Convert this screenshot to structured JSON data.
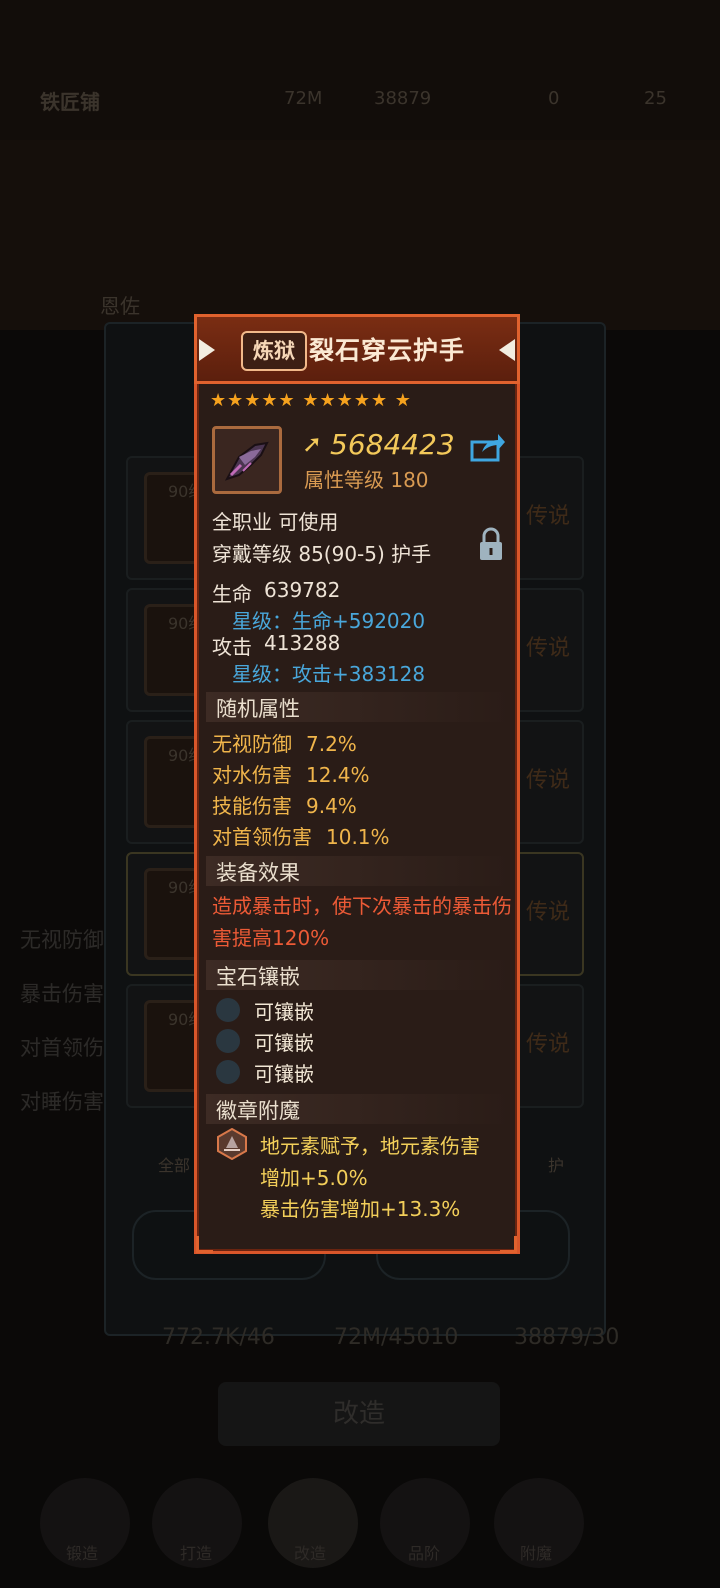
{
  "background": {
    "shop_name": "铁匠铺",
    "gold": "72M",
    "gems": "38879",
    "res_a": "0",
    "res_b": "25",
    "section_label": "恩佐",
    "row_level": "90级",
    "row_tag": "传说",
    "left_items": [
      "无视防御",
      "暴击伤害",
      "对首领伤",
      "对睡伤害"
    ],
    "filter_all": "全部",
    "filter_hand": "护",
    "stats": {
      "a": "772.7K/46",
      "b": "72M/45010",
      "c": "38879/30"
    },
    "modify_btn": "改造",
    "nav": [
      "锻造",
      "打造",
      "改造",
      "品阶",
      "附魔"
    ]
  },
  "item": {
    "tier_badge": "炼狱",
    "name": "裂石穿云护手",
    "stars": "★★★★★ ★★★★★ ★",
    "power": "5684423",
    "attr_level": "属性等级 180",
    "class_req": "全职业 可使用",
    "wear_req": "穿戴等级 85(90-5) 护手",
    "base_stats": [
      {
        "label": "生命",
        "value": "639782",
        "star_bonus": "星级：生命+592020"
      },
      {
        "label": "攻击",
        "value": "413288",
        "star_bonus": "星级：攻击+383128"
      }
    ],
    "random_title": "随机属性",
    "random_attrs": [
      {
        "label": "无视防御",
        "value": "7.2%"
      },
      {
        "label": "对水伤害",
        "value": "12.4%"
      },
      {
        "label": "技能伤害",
        "value": "9.4%"
      },
      {
        "label": "对首领伤害",
        "value": "10.1%"
      }
    ],
    "effect_title": "装备效果",
    "effect_text": "造成暴击时，使下次暴击的暴击伤害提高120%",
    "gem_title": "宝石镶嵌",
    "gem_slots": [
      "可镶嵌",
      "可镶嵌",
      "可镶嵌"
    ],
    "enchant_title": "徽章附魔",
    "enchant_lines": [
      "地元素赋予，地元素伤害",
      "增加+5.0%",
      "暴击伤害增加+13.3%"
    ]
  },
  "colors": {
    "frame": "#d8562a",
    "power": "#f3c95a",
    "star_bonus": "#49a7db",
    "effect": "#ec5a36"
  }
}
